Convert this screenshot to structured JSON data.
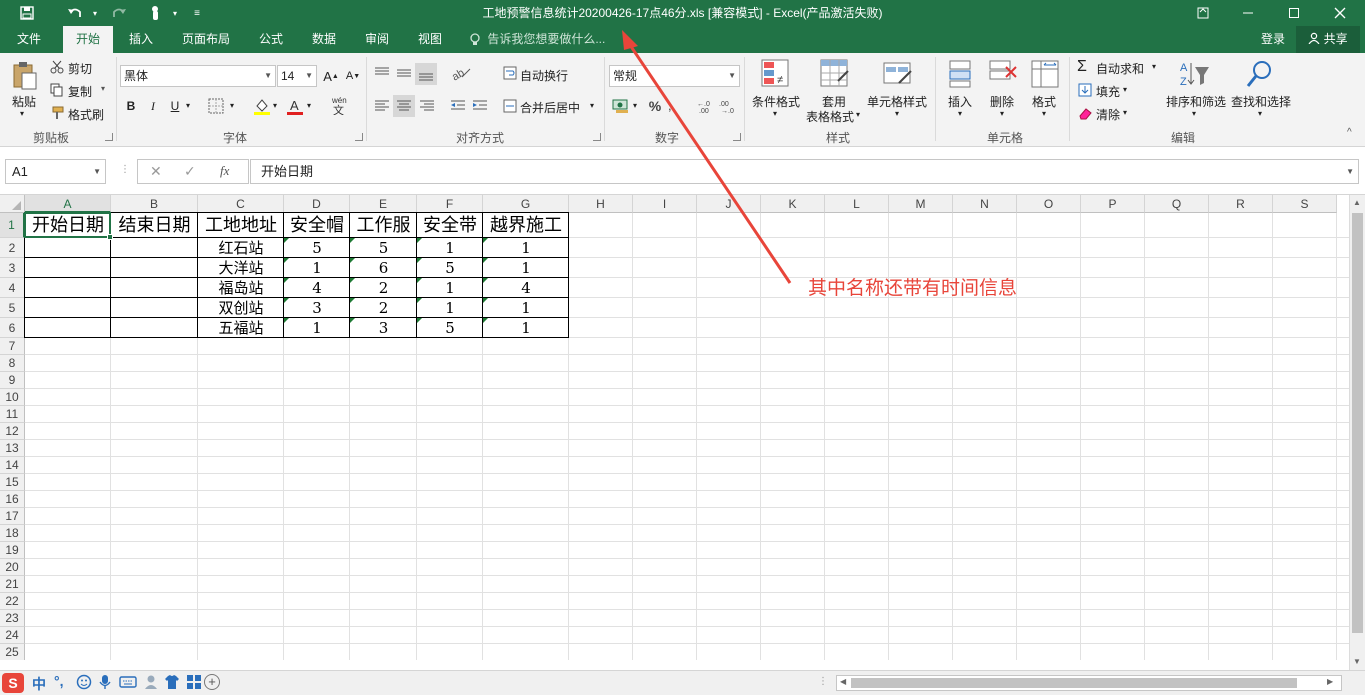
{
  "titlebar": {
    "title": "工地预警信息统计20200426-17点46分.xls  [兼容模式] - Excel(产品激活失败)",
    "save_icon": "save-icon",
    "undo_icon": "undo-icon",
    "redo_icon": "redo-icon",
    "touch_icon": "touch-mode-icon"
  },
  "tabs": [
    "文件",
    "开始",
    "插入",
    "页面布局",
    "公式",
    "数据",
    "审阅",
    "视图"
  ],
  "tell_me": "告诉我您想要做什么...",
  "account": {
    "login": "登录",
    "share": "共享"
  },
  "ribbon": {
    "clipboard": {
      "paste": "粘贴",
      "cut": "剪切",
      "copy": "复制",
      "format_painter": "格式刷",
      "label": "剪贴板"
    },
    "font": {
      "name": "黑体",
      "size": "14",
      "bold": "B",
      "italic": "I",
      "underline": "U",
      "label": "字体"
    },
    "alignment": {
      "wrap": "自动换行",
      "merge": "合并后居中",
      "label": "对齐方式"
    },
    "number": {
      "format": "常规",
      "percent": "%",
      "label": "数字"
    },
    "styles": {
      "conditional": "条件格式",
      "table_fmt_1": "套用",
      "table_fmt_2": "表格格式",
      "cell_styles": "单元格样式",
      "label": "样式"
    },
    "cells": {
      "insert": "插入",
      "delete": "删除",
      "format": "格式",
      "label": "单元格"
    },
    "editing": {
      "autosum": "自动求和",
      "fill": "填充",
      "clear": "清除",
      "sort": "排序和筛选",
      "find": "查找和选择",
      "label": "编辑"
    }
  },
  "formula_bar": {
    "name_box": "A1",
    "formula": "开始日期"
  },
  "columns": [
    "A",
    "B",
    "C",
    "D",
    "E",
    "F",
    "G",
    "H",
    "I",
    "J",
    "K",
    "L",
    "M",
    "N",
    "O",
    "P",
    "Q",
    "R",
    "S"
  ],
  "rows": [
    "1",
    "2",
    "3",
    "4",
    "5",
    "6",
    "7",
    "8",
    "9",
    "10",
    "11",
    "12",
    "13",
    "14",
    "15",
    "16",
    "17",
    "18",
    "19",
    "20",
    "21",
    "22",
    "23",
    "24",
    "25",
    "26"
  ],
  "table": {
    "headers": [
      "开始日期",
      "结束日期",
      "工地地址",
      "安全帽",
      "工作服",
      "安全带",
      "越界施工"
    ],
    "rows": [
      [
        "",
        "",
        "红石站",
        "5",
        "5",
        "1",
        "1"
      ],
      [
        "",
        "",
        "大洋站",
        "1",
        "6",
        "5",
        "1"
      ],
      [
        "",
        "",
        "福岛站",
        "4",
        "2",
        "1",
        "4"
      ],
      [
        "",
        "",
        "双创站",
        "3",
        "2",
        "1",
        "1"
      ],
      [
        "",
        "",
        "五福站",
        "1",
        "3",
        "5",
        "1"
      ]
    ]
  },
  "annotation": "其中名称还带有时间信息",
  "accent_color": "#217346",
  "annotation_color": "#e8453a",
  "taskbar": {
    "ime": "中"
  }
}
